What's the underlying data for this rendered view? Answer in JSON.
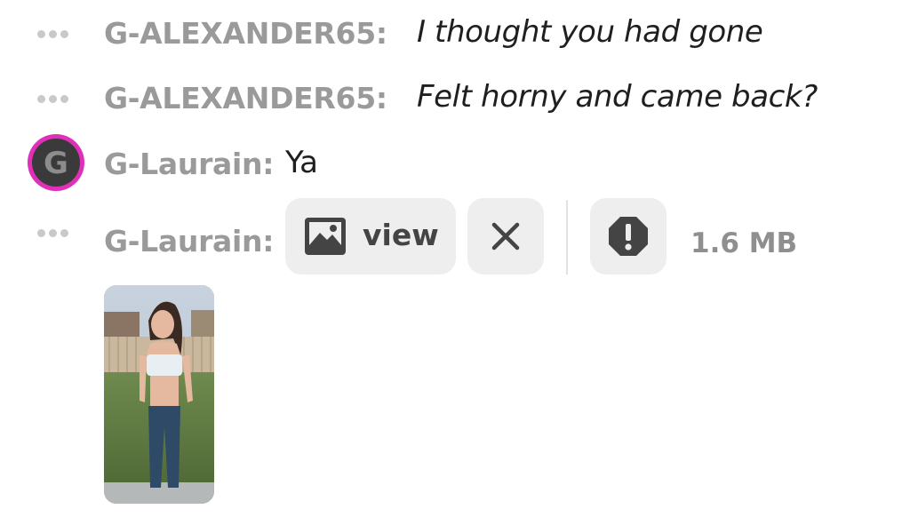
{
  "messages": [
    {
      "nick": "G-ALEXANDER65:",
      "text": "I thought you had gone",
      "style": "action"
    },
    {
      "nick": "G-ALEXANDER65:",
      "text": "Felt horny and came back?",
      "style": "action"
    },
    {
      "nick": "G-Laurain:",
      "text": "Ya",
      "style": "normal",
      "avatar_letter": "G"
    },
    {
      "nick": "G-Laurain:",
      "style": "media"
    }
  ],
  "media": {
    "view_label": "view",
    "file_size": "1.6 MB",
    "icons": [
      "image-icon",
      "close-icon",
      "report-icon"
    ]
  },
  "colors": {
    "nick": "#9a9a9a",
    "text": "#1f1f1f",
    "avatar_ring": "#e030b9",
    "avatar_fill": "#3a3a3a",
    "button_bg": "#eeeeee",
    "dots": "#c9c9c9"
  }
}
